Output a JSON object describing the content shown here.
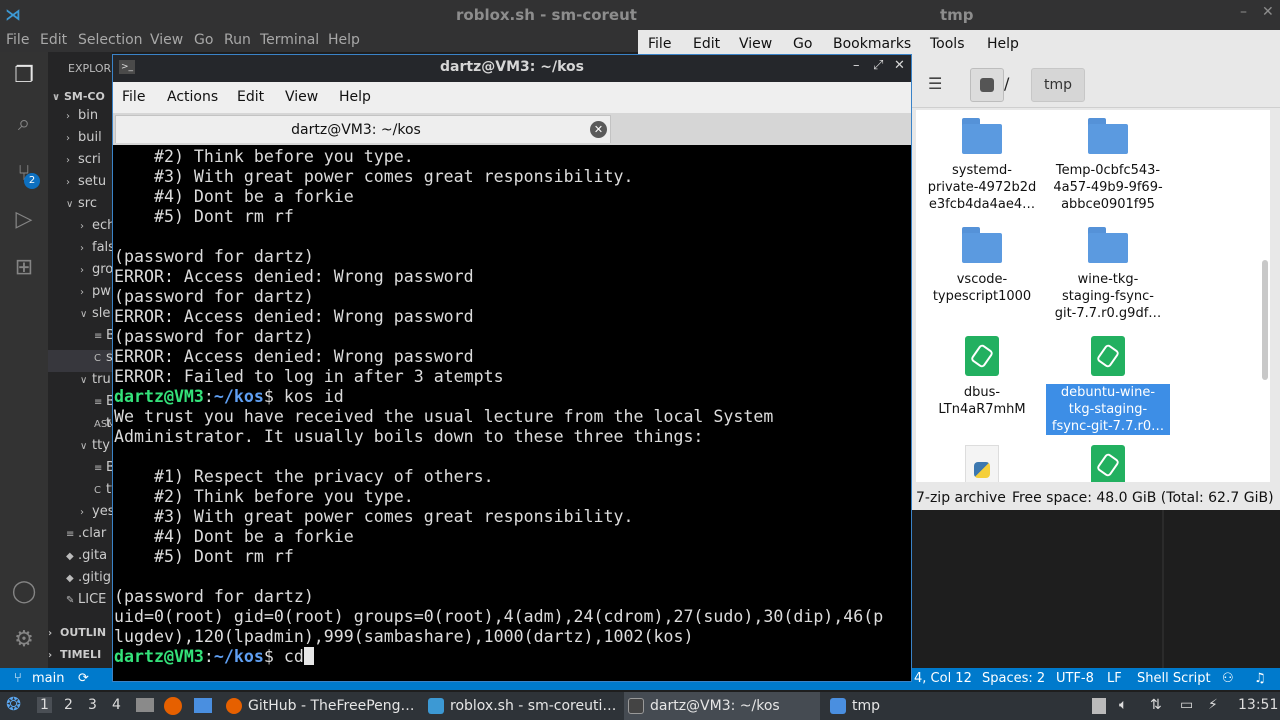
{
  "vscode": {
    "title": "roblox.sh - sm-coreuti",
    "menu": [
      "File",
      "Edit",
      "Selection",
      "View",
      "Go",
      "Run",
      "Terminal",
      "Help"
    ],
    "explorer_header": "EXPLOR",
    "tree": [
      {
        "label": "SM-CO",
        "chev": "∨",
        "indent": 0,
        "bold": true
      },
      {
        "label": "bin",
        "chev": "›",
        "indent": 1
      },
      {
        "label": "buil",
        "chev": "›",
        "indent": 1
      },
      {
        "label": "scri",
        "chev": "›",
        "indent": 1
      },
      {
        "label": "setu",
        "chev": "›",
        "indent": 1
      },
      {
        "label": "src",
        "chev": "∨",
        "indent": 1
      },
      {
        "label": "ech",
        "chev": "›",
        "indent": 2
      },
      {
        "label": "fals",
        "chev": "›",
        "indent": 2
      },
      {
        "label": "gro",
        "chev": "›",
        "indent": 2
      },
      {
        "label": "pw",
        "chev": "›",
        "indent": 2
      },
      {
        "label": "sle",
        "chev": "∨",
        "indent": 2
      },
      {
        "label": "Bu",
        "chev": "≡",
        "indent": 3
      },
      {
        "label": "sl",
        "chev": "C",
        "indent": 3,
        "selected": true
      },
      {
        "label": "tru",
        "chev": "∨",
        "indent": 2
      },
      {
        "label": "Bu",
        "chev": "≡",
        "indent": 3
      },
      {
        "label": "tr",
        "chev": "ASM",
        "indent": 3
      },
      {
        "label": "tty",
        "chev": "∨",
        "indent": 2
      },
      {
        "label": "Bu",
        "chev": "≡",
        "indent": 3
      },
      {
        "label": "tty",
        "chev": "C",
        "indent": 3
      },
      {
        "label": "yes",
        "chev": "›",
        "indent": 2
      },
      {
        "label": ".clar",
        "chev": "≡",
        "indent": 1
      },
      {
        "label": ".gita",
        "chev": "◆",
        "indent": 1
      },
      {
        "label": ".gitig",
        "chev": "◆",
        "indent": 1
      },
      {
        "label": "LICE",
        "chev": "✎",
        "indent": 1
      }
    ],
    "outline": "OUTLIN",
    "timeline": "TIMELI",
    "scm_badge": "2",
    "status": {
      "branch": "main",
      "position": "4, Col 12",
      "spaces": "Spaces: 2",
      "encoding": "UTF-8",
      "eol": "LF",
      "language": "Shell Script"
    }
  },
  "file_manager": {
    "title": "tmp",
    "menu": [
      "File",
      "Edit",
      "View",
      "Go",
      "Bookmarks",
      "Tools",
      "Help"
    ],
    "path_root": "/",
    "path_current": "tmp",
    "items": [
      {
        "type": "folder",
        "lines": [
          "systemd-",
          "private-4972b2d",
          "e3fcb4da4ae4…"
        ]
      },
      {
        "type": "folder",
        "lines": [
          "Temp-0cbfc543-",
          "4a57-49b9-9f69-",
          "abbce0901f95"
        ]
      },
      {
        "type": "folder",
        "lines": [
          "vscode-",
          "typescript1000"
        ]
      },
      {
        "type": "folder",
        "lines": [
          "wine-tkg-",
          "staging-fsync-",
          "git-7.7.r0.g9df…"
        ]
      },
      {
        "type": "pipe",
        "lines": [
          "dbus-",
          "LTn4aR7mhM"
        ]
      },
      {
        "type": "zip",
        "lines": [
          "debuntu-wine-",
          "tkg-staging-",
          "fsync-git-7.7.r0…"
        ],
        "selected": true
      },
      {
        "type": "python",
        "lines": []
      },
      {
        "type": "pipe",
        "lines": []
      }
    ],
    "status_type": "7-zip archive",
    "status_space": "Free space: 48.0 GiB (Total: 62.7 GiB)"
  },
  "terminal": {
    "title": "dartz@VM3: ~/kos",
    "menu": [
      "File",
      "Actions",
      "Edit",
      "View",
      "Help"
    ],
    "tab_label": "dartz@VM3: ~/kos",
    "lines": [
      {
        "t": "    #2) Think before you type."
      },
      {
        "t": "    #3) With great power comes great responsibility."
      },
      {
        "t": "    #4) Dont be a forkie"
      },
      {
        "t": "    #5) Dont rm rf"
      },
      {
        "t": ""
      },
      {
        "t": "(password for dartz)"
      },
      {
        "t": "ERROR: Access denied: Wrong password"
      },
      {
        "t": "(password for dartz)"
      },
      {
        "t": "ERROR: Access denied: Wrong password"
      },
      {
        "t": "(password for dartz)"
      },
      {
        "t": "ERROR: Access denied: Wrong password"
      },
      {
        "t": "ERROR: Failed to log in after 3 atempts"
      },
      {
        "user": "dartz@VM3",
        "path": "~/kos",
        "cmd": "$ kos id"
      },
      {
        "t": "We trust you have received the usual lecture from the local System"
      },
      {
        "t": "Administrator. It usually boils down to these three things:"
      },
      {
        "t": ""
      },
      {
        "t": "    #1) Respect the privacy of others."
      },
      {
        "t": "    #2) Think before you type."
      },
      {
        "t": "    #3) With great power comes great responsibility."
      },
      {
        "t": "    #4) Dont be a forkie"
      },
      {
        "t": "    #5) Dont rm rf"
      },
      {
        "t": ""
      },
      {
        "t": "(password for dartz)"
      },
      {
        "t": "uid=0(root) gid=0(root) groups=0(root),4(adm),24(cdrom),27(sudo),30(dip),46(p"
      },
      {
        "t": "lugdev),120(lpadmin),999(sambashare),1000(dartz),1002(kos)"
      },
      {
        "user": "dartz@VM3",
        "path": "~/kos",
        "cmd": "$ cd",
        "cursor": true
      }
    ]
  },
  "taskbar": {
    "workspaces": [
      "1",
      "2",
      "3",
      "4"
    ],
    "tasks": [
      {
        "label": "GitHub - TheFreePeng…",
        "icon_color": "#e66000"
      },
      {
        "label": "roblox.sh - sm-coreuti…",
        "icon_color": "#3c99d4"
      },
      {
        "label": "dartz@VM3: ~/kos",
        "icon_color": "#444444",
        "active": true
      },
      {
        "label": "tmp",
        "icon_color": "#4a8fe0"
      }
    ],
    "clock": "13:51"
  }
}
